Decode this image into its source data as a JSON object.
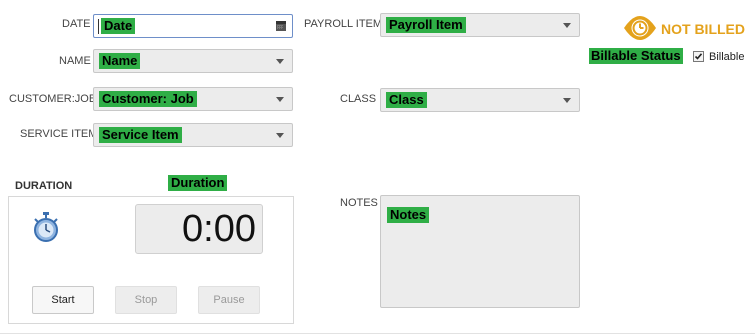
{
  "form": {
    "date": {
      "label": "DATE",
      "value": "Date"
    },
    "name": {
      "label": "NAME",
      "value": "Name"
    },
    "customer_job": {
      "label": "CUSTOMER:JOB",
      "value": "Customer: Job"
    },
    "service_item": {
      "label": "SERVICE ITEM",
      "value": "Service Item"
    },
    "payroll_item": {
      "label": "PAYROLL ITEM",
      "value": "Payroll Item"
    },
    "class": {
      "label": "CLASS",
      "value": "Class"
    },
    "notes": {
      "label": "NOTES",
      "value": "Notes"
    }
  },
  "duration": {
    "label": "DURATION",
    "highlight": "Duration",
    "time": "0:00",
    "start_label": "Start",
    "stop_label": "Stop",
    "pause_label": "Pause"
  },
  "billing": {
    "status_text": "NOT BILLED",
    "billable_status_label": "Billable Status",
    "billable_checkbox_label": "Billable",
    "billable_checked": true,
    "accent_color": "#e4a21c"
  },
  "colors": {
    "highlight": "#2fae46",
    "field_bg": "#ececec"
  }
}
